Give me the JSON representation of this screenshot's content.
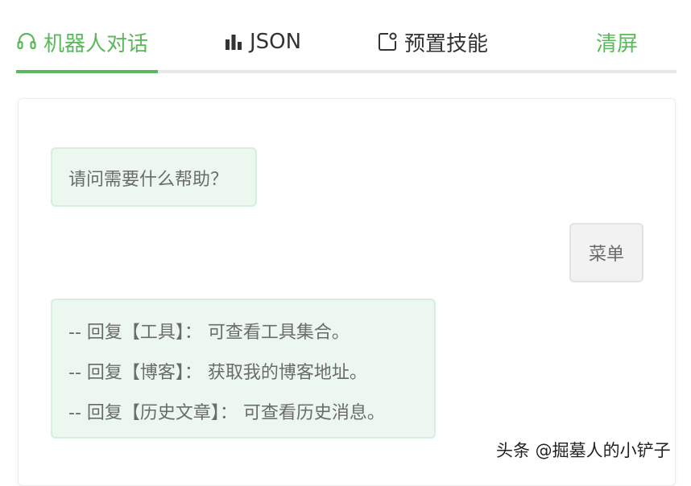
{
  "tabs": {
    "robot": "机器人对话",
    "json": "JSON",
    "skills": "预置技能",
    "clear": "清屏"
  },
  "colors": {
    "accent": "#5cb85c",
    "bot_bubble_bg": "#ecf8ef",
    "user_bubble_bg": "#f2f2f2"
  },
  "icons": {
    "robot_tab": "headset-icon",
    "json_tab": "bar-chart-icon",
    "skills_tab": "app-badge-icon"
  },
  "messages": {
    "greeting": "请问需要什么帮助？",
    "user_reply": "菜单",
    "menu": [
      "-- 回复【工具】： 可查看工具集合。",
      "-- 回复【博客】： 获取我的博客地址。",
      "-- 回复【历史文章】： 可查看历史消息。"
    ]
  },
  "watermark": "头条 @掘墓人的小铲子"
}
